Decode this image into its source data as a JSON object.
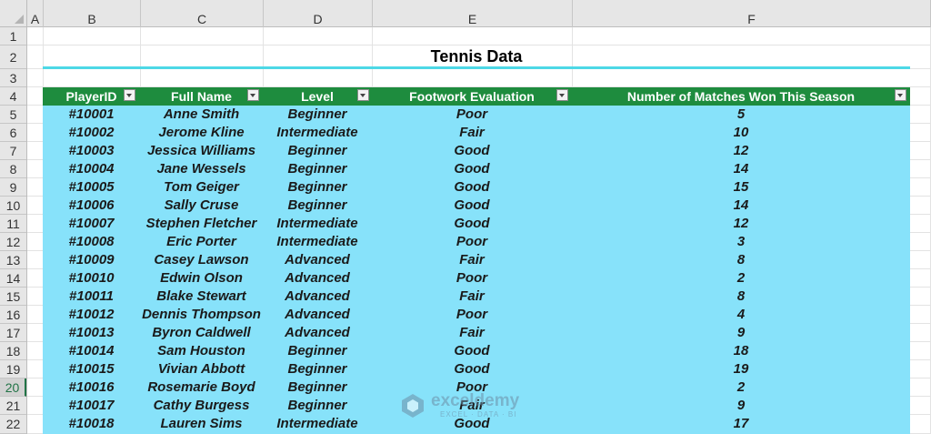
{
  "columns": [
    "A",
    "B",
    "C",
    "D",
    "E",
    "F"
  ],
  "rows": [
    "1",
    "2",
    "3",
    "4",
    "5",
    "6",
    "7",
    "8",
    "9",
    "10",
    "11",
    "12",
    "13",
    "14",
    "15",
    "16",
    "17",
    "18",
    "19",
    "20",
    "21",
    "22"
  ],
  "selected_row": "20",
  "title": "Tennis Data",
  "headers": {
    "id": "PlayerID",
    "name": "Full Name",
    "level": "Level",
    "footwork": "Footwork Evaluation",
    "matches": "Number of Matches Won This Season"
  },
  "data": [
    {
      "id": "#10001",
      "name": "Anne Smith",
      "level": "Beginner",
      "footwork": "Poor",
      "matches": "5"
    },
    {
      "id": "#10002",
      "name": "Jerome Kline",
      "level": "Intermediate",
      "footwork": "Fair",
      "matches": "10"
    },
    {
      "id": "#10003",
      "name": "Jessica Williams",
      "level": "Beginner",
      "footwork": "Good",
      "matches": "12"
    },
    {
      "id": "#10004",
      "name": "Jane Wessels",
      "level": "Beginner",
      "footwork": "Good",
      "matches": "14"
    },
    {
      "id": "#10005",
      "name": "Tom Geiger",
      "level": "Beginner",
      "footwork": "Good",
      "matches": "15"
    },
    {
      "id": "#10006",
      "name": "Sally Cruse",
      "level": "Beginner",
      "footwork": "Good",
      "matches": "14"
    },
    {
      "id": "#10007",
      "name": "Stephen Fletcher",
      "level": "Intermediate",
      "footwork": "Good",
      "matches": "12"
    },
    {
      "id": "#10008",
      "name": "Eric Porter",
      "level": "Intermediate",
      "footwork": "Poor",
      "matches": "3"
    },
    {
      "id": "#10009",
      "name": "Casey Lawson",
      "level": "Advanced",
      "footwork": "Fair",
      "matches": "8"
    },
    {
      "id": "#10010",
      "name": "Edwin Olson",
      "level": "Advanced",
      "footwork": "Poor",
      "matches": "2"
    },
    {
      "id": "#10011",
      "name": "Blake Stewart",
      "level": "Advanced",
      "footwork": "Fair",
      "matches": "8"
    },
    {
      "id": "#10012",
      "name": "Dennis Thompson",
      "level": "Advanced",
      "footwork": "Poor",
      "matches": "4"
    },
    {
      "id": "#10013",
      "name": "Byron Caldwell",
      "level": "Advanced",
      "footwork": "Fair",
      "matches": "9"
    },
    {
      "id": "#10014",
      "name": "Sam Houston",
      "level": "Beginner",
      "footwork": "Good",
      "matches": "18"
    },
    {
      "id": "#10015",
      "name": "Vivian Abbott",
      "level": "Beginner",
      "footwork": "Good",
      "matches": "19"
    },
    {
      "id": "#10016",
      "name": "Rosemarie Boyd",
      "level": "Beginner",
      "footwork": "Poor",
      "matches": "2"
    },
    {
      "id": "#10017",
      "name": "Cathy Burgess",
      "level": "Beginner",
      "footwork": "Fair",
      "matches": "9"
    },
    {
      "id": "#10018",
      "name": "Lauren Sims",
      "level": "Intermediate",
      "footwork": "Good",
      "matches": "17"
    }
  ],
  "watermark": {
    "name": "exceldemy",
    "tagline": "EXCEL · DATA · BI"
  },
  "colors": {
    "header_bg": "#1e8c3e",
    "body_bg": "#87e2fa",
    "title_line": "#4dd8e6"
  }
}
